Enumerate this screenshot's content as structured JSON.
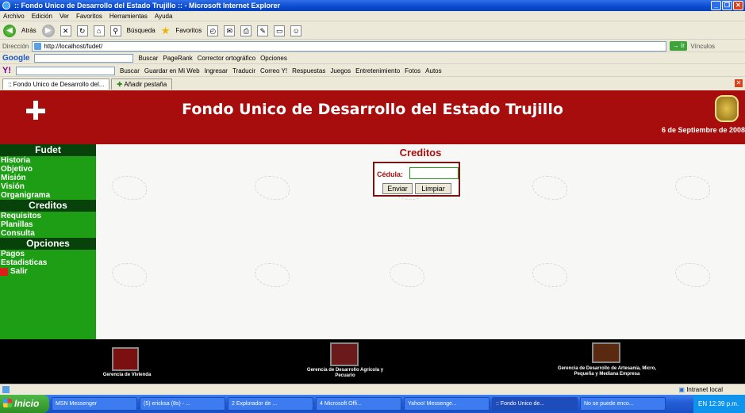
{
  "window": {
    "title": ":: Fondo Unico de Desarrollo del Estado Trujillo :: - Microsoft Internet Explorer"
  },
  "menubar": {
    "items": [
      "Archivo",
      "Edición",
      "Ver",
      "Favoritos",
      "Herramientas",
      "Ayuda"
    ]
  },
  "toolbar": {
    "back": "Atrás",
    "search": "Búsqueda",
    "favorites": "Favoritos"
  },
  "address": {
    "label": "Dirección",
    "url": "http://localhost/fudet/",
    "go": "Ir",
    "links": "Vínculos"
  },
  "google_bar": {
    "logo": "Google",
    "buscar": "Buscar",
    "pagerank": "PageRank",
    "corrector": "Corrector ortográfico",
    "opciones": "Opciones"
  },
  "yahoo_bar": {
    "logo": "Y!",
    "buscar": "Buscar",
    "items": [
      "Guardar en Mi Web",
      "Ingresar",
      "Traducir",
      "Correo Y!",
      "Respuestas",
      "Juegos",
      "Entretenimiento",
      "Fotos",
      "Autos"
    ]
  },
  "tabs": {
    "current": ":: Fondo Unico de Desarrollo del...",
    "new": "Añadir pestaña"
  },
  "site": {
    "title": "Fondo Unico de Desarrollo del Estado Trujillo",
    "date": "6 de Septiembre de 2008",
    "sidebar": {
      "sections": [
        {
          "heading": "Fudet",
          "links": [
            "Historia",
            "Objetivo",
            "Misión",
            "Visión",
            "Organigrama"
          ]
        },
        {
          "heading": "Creditos",
          "links": [
            "Requisitos",
            "Planillas",
            "Consulta"
          ]
        },
        {
          "heading": "Opciones",
          "links": [
            "Pagos",
            "Estadisticas"
          ]
        }
      ],
      "salir": "Salir"
    },
    "content": {
      "title": "Creditos",
      "cedula_label": "Cédula:",
      "cedula_value": "",
      "enviar": "Enviar",
      "limpiar": "Limpiar"
    },
    "footer": {
      "items": [
        "Gerencia de Vivienda",
        "Gerencia de Desarrollo Agrícola y Pecuario",
        "Gerencia de Desarrollo de Artesanía, Micro, Pequeña y Mediana Empresa"
      ]
    }
  },
  "statusbar": {
    "zone": "Intranet local"
  },
  "taskbar": {
    "start": "Inicio",
    "tasks": [
      "MSN Messenger",
      "(5) ericksa (8s) - ...",
      "2 Explorador de ...",
      "4 Microsoft Offi...",
      "Yahoo! Messenge...",
      ":: Fondo Unico de...",
      "No se puede enco..."
    ],
    "lang": "EN",
    "time": "12:39 p.m."
  }
}
